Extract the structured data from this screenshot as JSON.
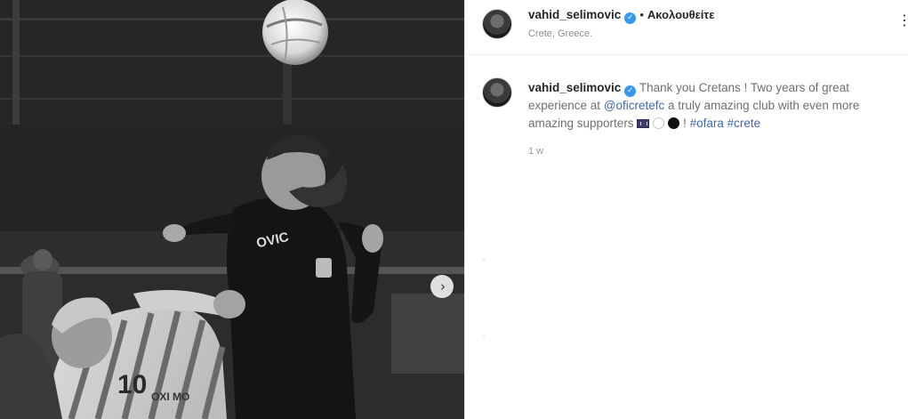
{
  "post": {
    "username": "vahid_selimovic",
    "verified_mark": "✓",
    "separator": "•",
    "follow_label": "Ακολουθείτε",
    "location": "Crete, Greece.",
    "more_label": "⋮"
  },
  "caption": {
    "username": "vahid_selimovic",
    "text_part1": "Thank you Cretans ! Two years of great experience at ",
    "mention": "@oficretefc",
    "text_part2": " a truly amazing club with even more amazing supporters ",
    "text_part3": " ! ",
    "hashtag1": "#ofara",
    "hashtag2": "#crete",
    "timestamp": "1 w"
  },
  "media": {
    "next_label": "›",
    "jersey_number": "10",
    "jersey_name": "OVIC",
    "shirt_sponsor": "ΟΧΙ ΜΟ"
  },
  "colors": {
    "link": "#4068a8",
    "verified": "#3897f0",
    "muted": "#8e8e8e"
  }
}
